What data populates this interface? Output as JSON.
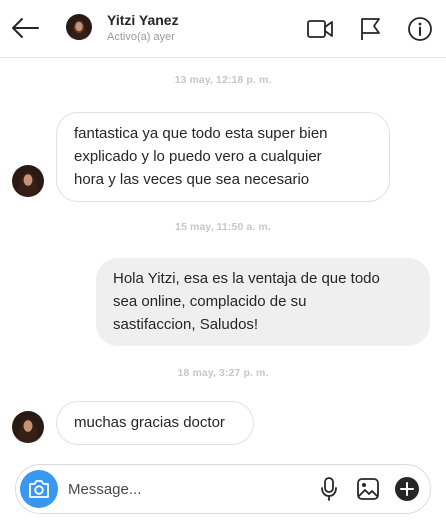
{
  "header": {
    "name": "Yitzi Yanez",
    "status": "Activo(a) ayer",
    "icons": [
      "back-arrow-icon",
      "video-call-icon",
      "flag-icon",
      "info-icon"
    ]
  },
  "thread": {
    "timestamps": [
      "13 may, 12:18 p. m.",
      "15 may, 11:50 a. m.",
      "18 may, 3:27 p. m."
    ],
    "messages": [
      {
        "from": "contact",
        "lines": [
          " fantastica ya que todo esta super bien",
          "explicado y lo puedo vero a cualquier",
          "hora y las veces que sea necesario"
        ]
      },
      {
        "from": "me",
        "lines": [
          "Hola Yitzi, esa es la ventaja de que todo",
          "sea online, complacido de su",
          "sastifaccion, Saludos!"
        ]
      },
      {
        "from": "contact",
        "lines": [
          "muchas gracias doctor"
        ]
      }
    ]
  },
  "composer": {
    "placeholder": "Message...",
    "icons": [
      "camera-icon",
      "microphone-icon",
      "image-icon",
      "add-icon"
    ],
    "accent": "#3897f0"
  }
}
